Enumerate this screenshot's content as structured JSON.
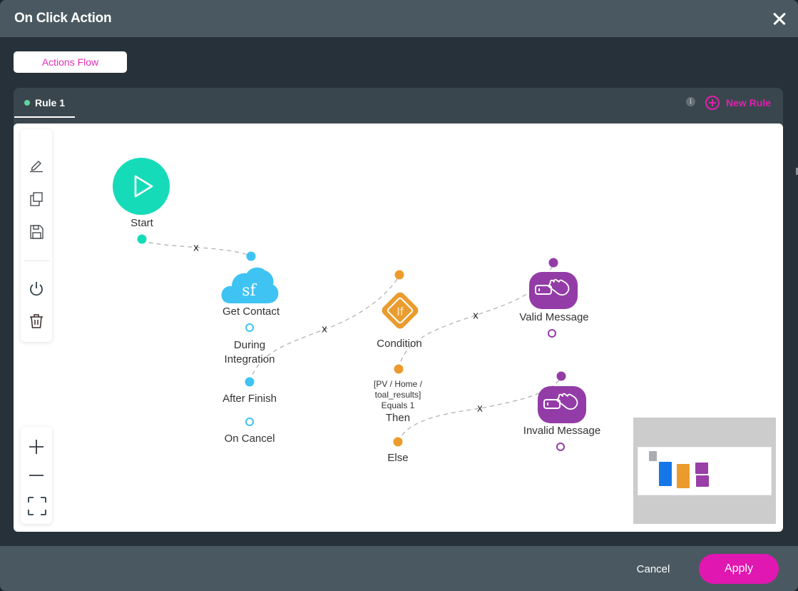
{
  "modal": {
    "title": "On Click Action",
    "close_icon": "close-icon"
  },
  "flow_tab": {
    "label": "Actions Flow"
  },
  "rules": {
    "tabs": [
      {
        "label": "Rule 1",
        "status_color": "#5fd6a0",
        "active": true
      }
    ],
    "info_icon_glyph": "i",
    "new_rule_label": "New Rule"
  },
  "toolbar": {
    "items": [
      {
        "name": "edit",
        "icon": "pencil-icon"
      },
      {
        "name": "duplicate",
        "icon": "copy-icon"
      },
      {
        "name": "save",
        "icon": "save-icon"
      },
      {
        "name": "toggle",
        "icon": "power-icon"
      },
      {
        "name": "delete",
        "icon": "trash-icon"
      }
    ],
    "zoom_items": [
      {
        "name": "zoom-in",
        "icon": "plus-icon"
      },
      {
        "name": "zoom-out",
        "icon": "minus-icon"
      },
      {
        "name": "fit",
        "icon": "fit-screen-icon"
      }
    ]
  },
  "flow": {
    "nodes": {
      "start": {
        "label": "Start",
        "color": "#16dbb9"
      },
      "get_contact": {
        "label": "Get Contact",
        "icon_text": "sf",
        "color": "#3fc3f3",
        "outputs": [
          "During Integration",
          "After Finish",
          "On Cancel"
        ]
      },
      "condition": {
        "label": "Condition",
        "icon_text": "If",
        "color": "#ea9c2e",
        "then_expression_line1": "[PV / Home /",
        "then_expression_line2": "toal_results]",
        "then_expression_line3": "Equals 1",
        "then_label": "Then",
        "else_label": "Else"
      },
      "valid_message": {
        "label": "Valid Message",
        "color": "#933ca7"
      },
      "invalid_message": {
        "label": "Invalid Message",
        "color": "#933ca7"
      }
    },
    "edge_remove_glyph": "x",
    "edges": [
      {
        "from": "Start",
        "to": "Get Contact"
      },
      {
        "from": "Get Contact / After Finish",
        "to": "Condition"
      },
      {
        "from": "Condition / Then",
        "to": "Valid Message"
      },
      {
        "from": "Condition / Else",
        "to": "Invalid Message"
      }
    ]
  },
  "minimap": {
    "colors": [
      "#a9adaf",
      "#1677e6",
      "#eb9b2d",
      "#9a3ea8",
      "#9a3ea8"
    ]
  },
  "footer": {
    "cancel_label": "Cancel",
    "apply_label": "Apply",
    "apply_color": "#e017b0"
  }
}
